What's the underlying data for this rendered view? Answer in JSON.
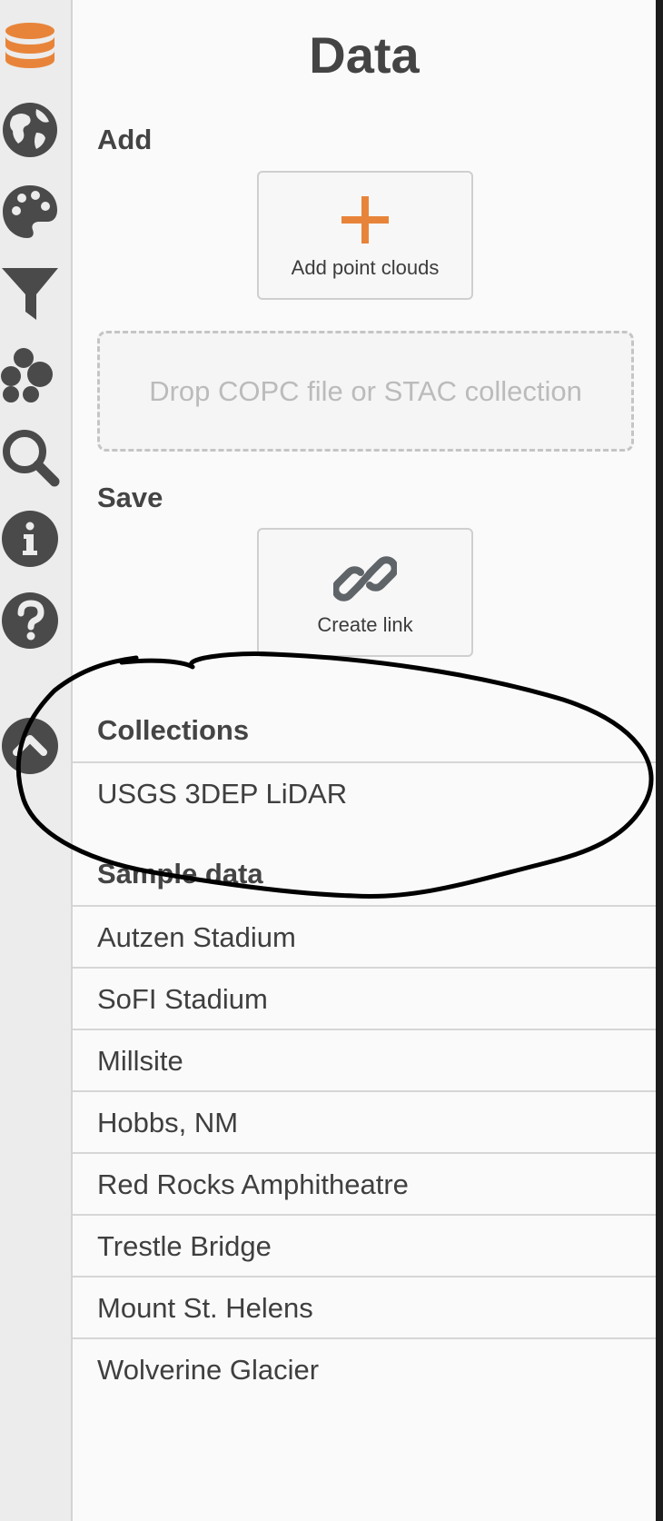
{
  "sidebar": {
    "tabs": [
      {
        "icon": "database-icon",
        "active": true
      },
      {
        "icon": "globe-icon"
      },
      {
        "icon": "palette-icon"
      },
      {
        "icon": "filter-icon"
      },
      {
        "icon": "layers-icon"
      },
      {
        "icon": "search-icon"
      },
      {
        "icon": "info-icon"
      },
      {
        "icon": "help-icon"
      },
      {
        "icon": "collapse-icon"
      }
    ],
    "colors": {
      "active": "#e8843a",
      "inactive": "#4a4a4a"
    }
  },
  "panel": {
    "title": "Data",
    "add": {
      "heading": "Add",
      "button_label": "Add point clouds",
      "drop_placeholder": "Drop COPC file or STAC collection"
    },
    "save": {
      "heading": "Save",
      "button_label": "Create link"
    },
    "collections": {
      "heading": "Collections",
      "items": [
        "USGS 3DEP LiDAR"
      ]
    },
    "sample_data": {
      "heading": "Sample data",
      "items": [
        "Autzen Stadium",
        "SoFI Stadium",
        "Millsite",
        "Hobbs, NM",
        "Red Rocks Amphitheatre",
        "Trestle Bridge",
        "Mount St. Helens",
        "Wolverine Glacier"
      ]
    }
  },
  "colors": {
    "accent": "#e8843a",
    "text": "#3f3f3f",
    "annotation": "#000000"
  }
}
